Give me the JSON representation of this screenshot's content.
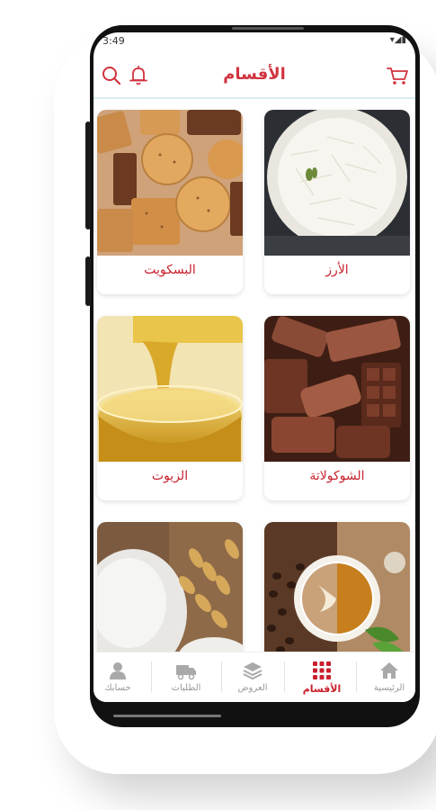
{
  "status": {
    "time": "3:49",
    "icons": "▾◢▮"
  },
  "header": {
    "title": "الأقسام",
    "icons": [
      "search-icon",
      "bell-icon",
      "cart-icon"
    ],
    "accent": "#d0333e"
  },
  "categories": [
    {
      "name": "الأرز"
    },
    {
      "name": "البسكويت"
    },
    {
      "name": "الشوكولاتة"
    },
    {
      "name": "الزيوت"
    },
    {
      "name": ""
    },
    {
      "name": ""
    }
  ],
  "nav": {
    "items": [
      {
        "label": "الرئيسية",
        "icon": "home-icon"
      },
      {
        "label": "الأقسام",
        "icon": "grid-icon",
        "active": true
      },
      {
        "label": "العروض",
        "icon": "layers-icon"
      },
      {
        "label": "الطلبات",
        "icon": "truck-icon"
      },
      {
        "label": "حسابك",
        "icon": "user-icon"
      }
    ]
  }
}
